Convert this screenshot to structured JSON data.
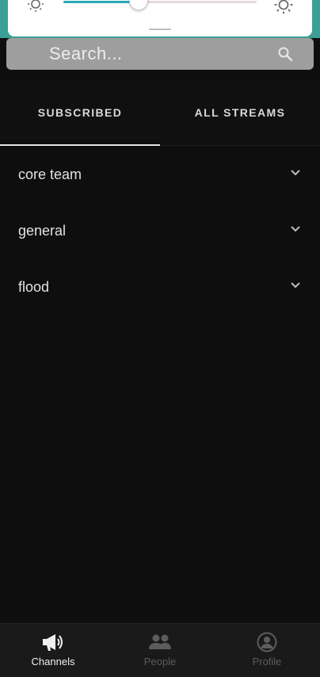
{
  "search": {
    "placeholder": "Search..."
  },
  "brightness": {
    "level": 0.39
  },
  "tabs": [
    {
      "label": "SUBSCRIBED",
      "active": true
    },
    {
      "label": "ALL STREAMS",
      "active": false
    }
  ],
  "streams": [
    {
      "name": "core team"
    },
    {
      "name": "general"
    },
    {
      "name": "flood"
    }
  ],
  "nav": [
    {
      "label": "Channels",
      "icon": "megaphone-icon",
      "active": true
    },
    {
      "label": "People",
      "icon": "people-icon",
      "active": false
    },
    {
      "label": "Profile",
      "icon": "profile-icon",
      "active": false
    }
  ],
  "colors": {
    "app_bar": "#3c9f95",
    "background": "#0e0e0e",
    "slider_fill": "#2aa7b7",
    "search_bg": "#9e9e9e"
  }
}
